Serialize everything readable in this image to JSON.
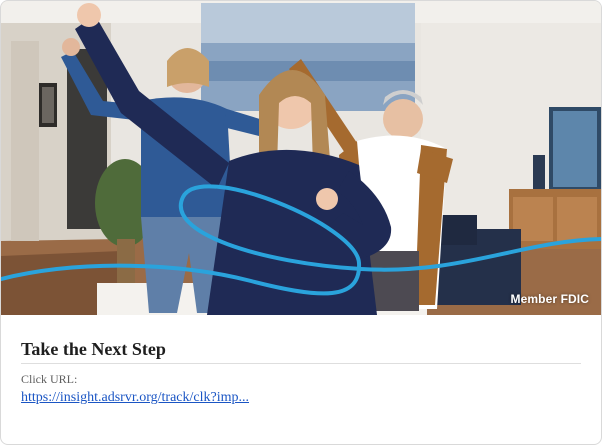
{
  "ad": {
    "image_alt": "Three people dancing in a living room",
    "disclosure": "Member FDIC",
    "title": "Take the Next Step",
    "click_url_label": "Click URL:",
    "click_url": "https://insight.adsrvr.org/track/clk?imp..."
  },
  "colors": {
    "accent_line": "#2aa3dc",
    "link": "#1a55c4"
  }
}
